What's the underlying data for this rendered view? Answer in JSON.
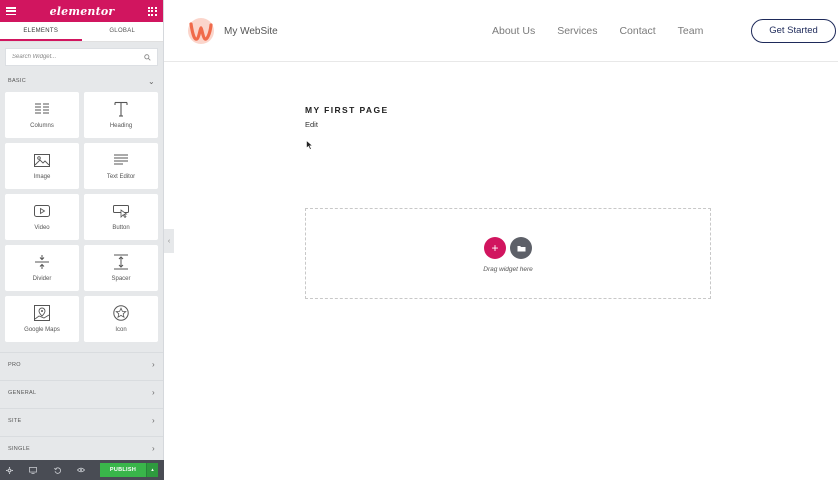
{
  "sidebar": {
    "logo": "elementor",
    "tabs": [
      {
        "label": "ELEMENTS",
        "active": true
      },
      {
        "label": "GLOBAL",
        "active": false
      }
    ],
    "search": {
      "placeholder": "Search Widget..."
    },
    "section_basic": "BASIC",
    "widgets": [
      {
        "label": "Columns",
        "icon": "columns-icon"
      },
      {
        "label": "Heading",
        "icon": "heading-icon"
      },
      {
        "label": "Image",
        "icon": "image-icon"
      },
      {
        "label": "Text Editor",
        "icon": "text-editor-icon"
      },
      {
        "label": "Video",
        "icon": "video-icon"
      },
      {
        "label": "Button",
        "icon": "button-icon"
      },
      {
        "label": "Divider",
        "icon": "divider-icon"
      },
      {
        "label": "Spacer",
        "icon": "spacer-icon"
      },
      {
        "label": "Google Maps",
        "icon": "google-maps-icon"
      },
      {
        "label": "Icon",
        "icon": "star-icon"
      }
    ],
    "collapsed_sections": [
      "PRO",
      "GENERAL",
      "SITE",
      "SINGLE"
    ],
    "bottom": {
      "publish_label": "PUBLISH"
    }
  },
  "site": {
    "brand_name": "My WebSite",
    "nav": [
      "About Us",
      "Services",
      "Contact",
      "Team"
    ],
    "cta_label": "Get Started"
  },
  "page": {
    "title": "MY FIRST PAGE",
    "edit_label": "Edit",
    "dropzone_text": "Drag widget here",
    "add_label": "+"
  },
  "colors": {
    "accent": "#d1155f",
    "publish": "#39b54a",
    "brand_logo": "#f06a4a",
    "cta_border": "#1e2a5a"
  }
}
